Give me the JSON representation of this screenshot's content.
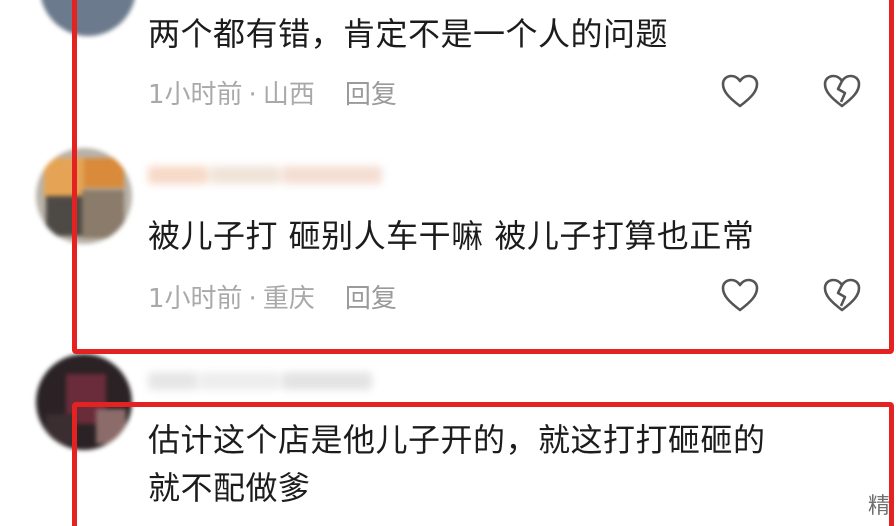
{
  "comments": [
    {
      "text": "两个都有错，肯定不是一个人的问题",
      "time": "1小时前",
      "location": "山西",
      "reply": "回复"
    },
    {
      "text": "被儿子打 砸别人车干嘛 被儿子打算也正常",
      "time": "1小时前",
      "location": "重庆",
      "reply": "回复"
    },
    {
      "text_line1": "估计这个店是他儿子开的，就这打打砸砸的",
      "text_line2": "就不配做爹"
    }
  ],
  "separator": "·",
  "icons": {
    "like": "heart-outline-icon",
    "dislike": "broken-heart-icon"
  },
  "colors": {
    "highlight": "#e52222",
    "text": "#1c1c1c",
    "meta": "#a9a9a9"
  },
  "corner_mark": "精"
}
